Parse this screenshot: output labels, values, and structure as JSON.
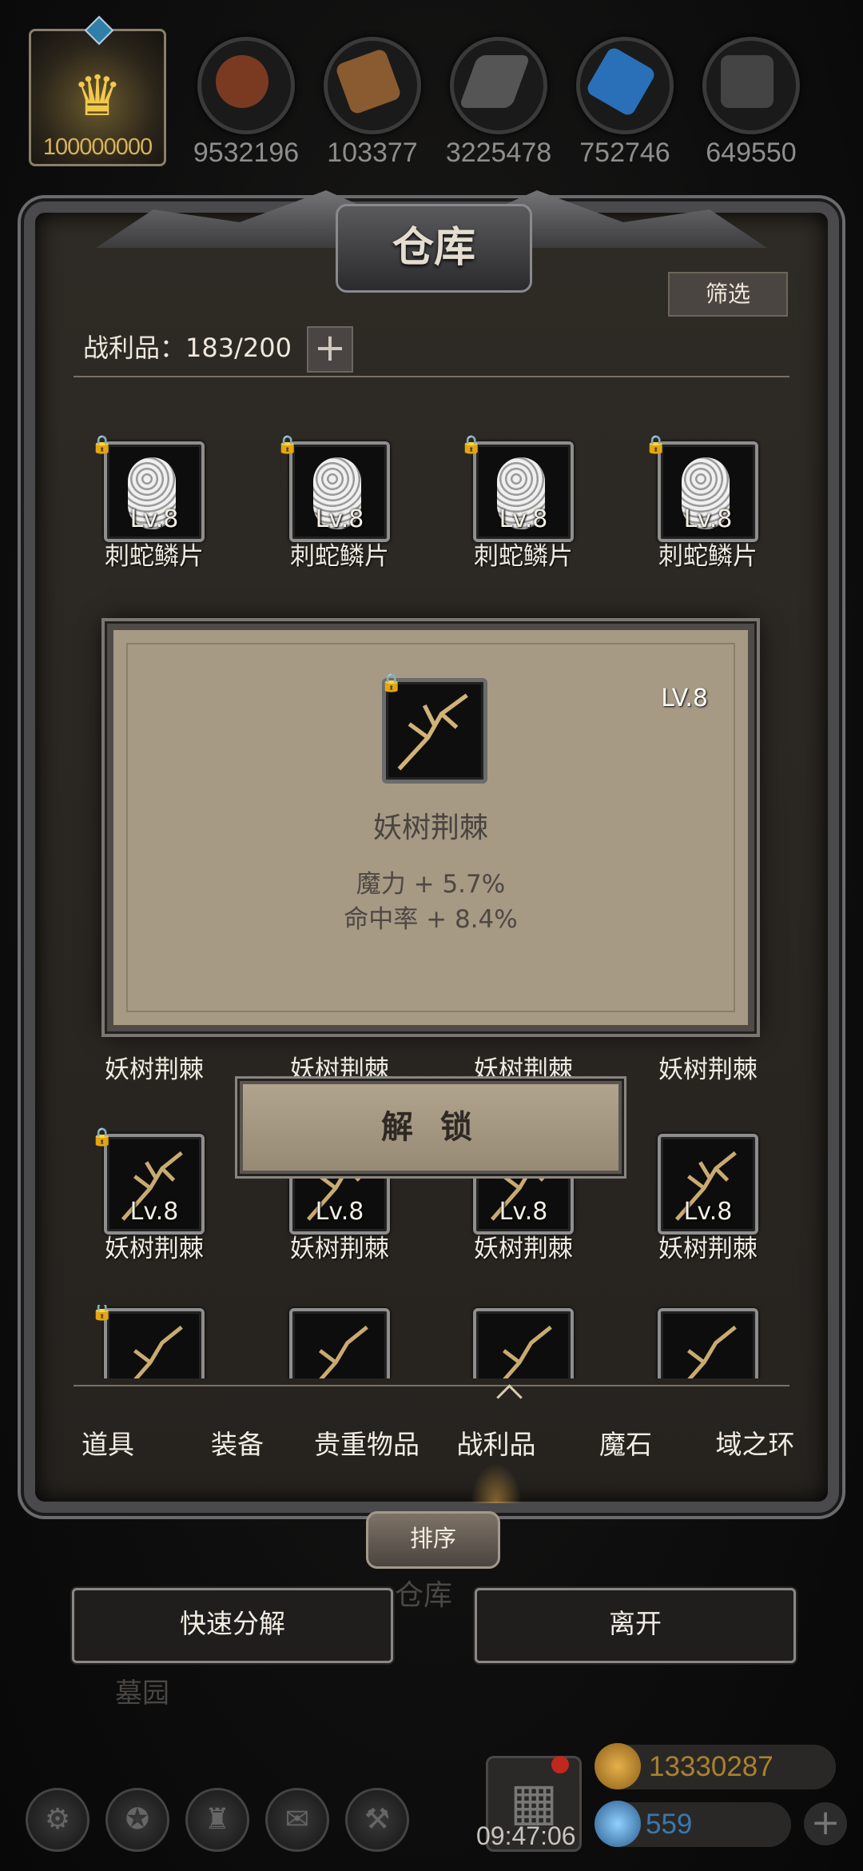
{
  "crown": {
    "value": "100000000"
  },
  "resources": [
    {
      "icon": "meat-icon",
      "value": "9532196",
      "color": "#7a3a22"
    },
    {
      "icon": "wood-icon",
      "value": "103377",
      "color": "#8a5a30"
    },
    {
      "icon": "iron-icon",
      "value": "3225478",
      "color": "#555555"
    },
    {
      "icon": "crystal-icon",
      "value": "752746",
      "color": "#2a70b8"
    },
    {
      "icon": "stone-icon",
      "value": "649550",
      "color": "#444444"
    }
  ],
  "window": {
    "title": "仓库",
    "filter_label": "筛选"
  },
  "capacity": {
    "text": "战利品：183/200"
  },
  "grid": {
    "row1": [
      {
        "level": "Lv.8",
        "name": "刺蛇鳞片"
      },
      {
        "level": "Lv.8",
        "name": "刺蛇鳞片"
      },
      {
        "level": "Lv.8",
        "name": "刺蛇鳞片"
      },
      {
        "level": "Lv.8",
        "name": "刺蛇鳞片"
      }
    ],
    "row2_names": [
      "妖树荆棘",
      "妖树荆棘",
      "妖树荆棘",
      "妖树荆棘"
    ],
    "row3": [
      {
        "level": "Lv.8",
        "name": "妖树荆棘"
      },
      {
        "level": "Lv.8",
        "name": "妖树荆棘"
      },
      {
        "level": "Lv.8",
        "name": "妖树荆棘"
      },
      {
        "level": "Lv.8",
        "name": "妖树荆棘"
      }
    ]
  },
  "popup": {
    "level": "LV.8",
    "name": "妖树荆棘",
    "stats": [
      "魔力 + 5.7%",
      "命中率 + 8.4%"
    ]
  },
  "unlock_label": "解 锁",
  "tabs": [
    {
      "label": "道具"
    },
    {
      "label": "装备"
    },
    {
      "label": "贵重物品"
    },
    {
      "label": "战利品",
      "active": true
    },
    {
      "label": "魔石"
    },
    {
      "label": "域之环"
    }
  ],
  "sort_label": "排序",
  "background_labels": {
    "warehouse": "仓库",
    "cemetery": "墓园"
  },
  "actions": {
    "quick_decompose": "快速分解",
    "leave": "离开"
  },
  "bottom": {
    "time": "09:47:06",
    "gold": "13330287",
    "gems": "559",
    "gold_color": "#a8822e",
    "gem_color": "#3a78b0"
  }
}
